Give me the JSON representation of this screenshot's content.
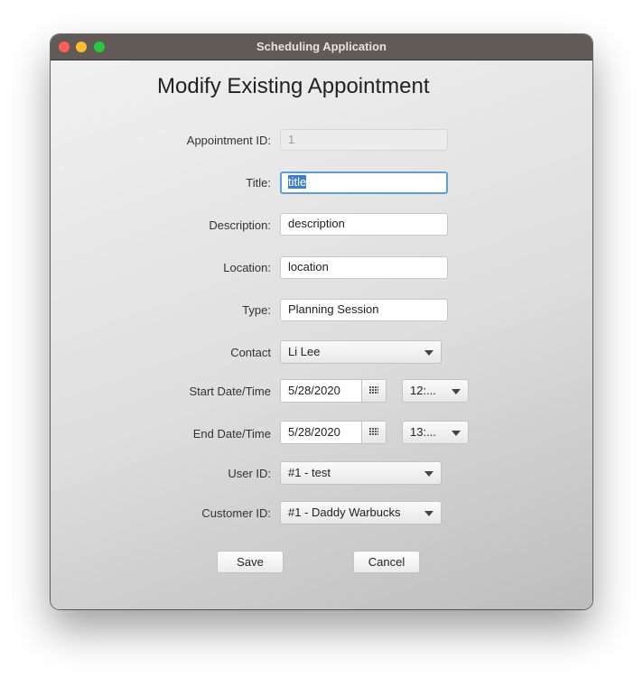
{
  "window": {
    "title": "Scheduling Application"
  },
  "form": {
    "heading": "Modify Existing Appointment",
    "appointment_id": {
      "label": "Appointment ID:",
      "value": "1"
    },
    "title": {
      "label": "Title:",
      "value": "title"
    },
    "description": {
      "label": "Description:",
      "value": "description"
    },
    "location": {
      "label": "Location:",
      "value": "location"
    },
    "type": {
      "label": "Type:",
      "value": "Planning Session"
    },
    "contact": {
      "label": "Contact",
      "value": "Li Lee"
    },
    "start": {
      "label": "Start Date/Time",
      "date": "5/28/2020",
      "time": "12:..."
    },
    "end": {
      "label": "End Date/Time",
      "date": "5/28/2020",
      "time": "13:..."
    },
    "user_id": {
      "label": "User ID:",
      "value": "#1 - test"
    },
    "customer_id": {
      "label": "Customer ID:",
      "value": "#1 - Daddy Warbucks"
    },
    "save_label": "Save",
    "cancel_label": "Cancel"
  },
  "colors": {
    "titlebar": "#615a56",
    "close": "#ff5f57",
    "minimize": "#febc2e",
    "maximize": "#28c840",
    "focus_ring": "#5e9ed6",
    "selection": "#3d7fc4"
  },
  "icons": {
    "calendar": "calendar-icon",
    "dropdown": "chevron-down-icon"
  }
}
